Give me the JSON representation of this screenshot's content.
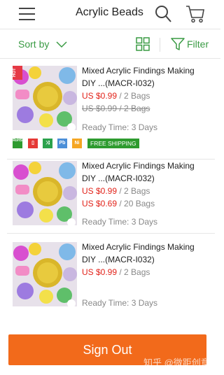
{
  "header": {
    "title": "Acrylic Beads",
    "menu_icon": "hamburger-menu-icon",
    "search_icon": "search-icon",
    "cart_icon": "cart-icon"
  },
  "toolbar": {
    "sort_label": "Sort by",
    "filter_label": "Filter",
    "accent_color": "#3a9b44"
  },
  "products": [
    {
      "hot": "HOT",
      "title": "Mixed Acrylic Findings Making DIY ...(MACR-I032)",
      "prices": [
        {
          "amount": "US $0.99",
          "qty": " / 2 Bags",
          "struck": false
        },
        {
          "amount": "US $0.99",
          "qty": " / 2 Bags",
          "struck": true
        }
      ],
      "ready": "Ready Time: 3 Days",
      "badges": [
        "RoHS",
        "Pb",
        "Ni"
      ],
      "free_shipping": "FREE SHIPPING"
    },
    {
      "title": "Mixed Acrylic Findings Making DIY ...(MACR-I032)",
      "prices": [
        {
          "amount": "US $0.99",
          "qty": " / 2 Bags",
          "struck": false
        },
        {
          "amount": "US $0.69",
          "qty": " / 20 Bags",
          "struck": false
        }
      ],
      "ready": "Ready Time: 3 Days"
    },
    {
      "title": "Mixed Acrylic Findings Making DIY ...(MACR-I032)",
      "prices": [
        {
          "amount": "US $0.99",
          "qty": " / 2 Bags",
          "struck": false
        }
      ],
      "ready": "Ready Time: 3 Days"
    }
  ],
  "footer": {
    "sign_out_label": "Sign Out",
    "button_color": "#f26a1b",
    "watermark": "知乎 @微距创意"
  },
  "colors": {
    "price_red": "#e2231a",
    "muted_gray": "#888888"
  }
}
